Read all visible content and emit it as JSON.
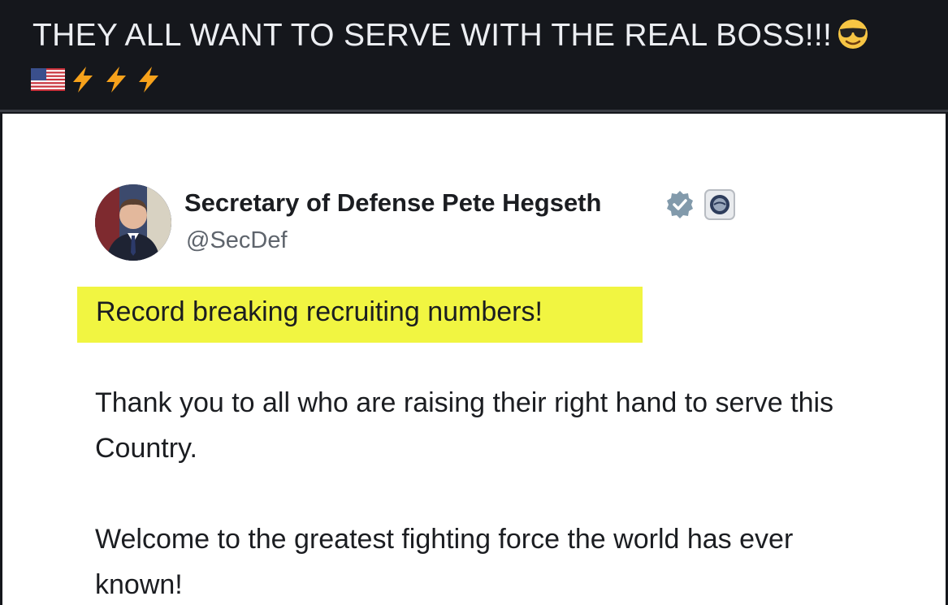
{
  "caption": {
    "text": "THEY ALL WANT TO SERVE WITH THE REAL BOSS!!!",
    "emoji_end": "smiling-face-with-sunglasses-icon",
    "emoji_line2": [
      "us-flag-icon",
      "lightning-icon",
      "lightning-icon",
      "lightning-icon"
    ]
  },
  "tweet": {
    "author_name": "Secretary of Defense Pete Hegseth",
    "handle": "@SecDef",
    "verified_badge": "verified-badge-icon",
    "affiliation_badge": "government-affiliation-icon",
    "highlighted_text": "Record breaking recruiting numbers!",
    "paragraph_1": "Thank you to all who are raising their right hand to serve this Country.",
    "paragraph_2": "Welcome to the greatest fighting force the world has ever known!"
  },
  "colors": {
    "caption_background": "#15171c",
    "caption_text": "#eceef2",
    "card_background": "#ffffff",
    "highlight": "#f1f541",
    "body_text": "#1b1d21",
    "handle_text": "#5e646c",
    "verified": "#829aab"
  }
}
